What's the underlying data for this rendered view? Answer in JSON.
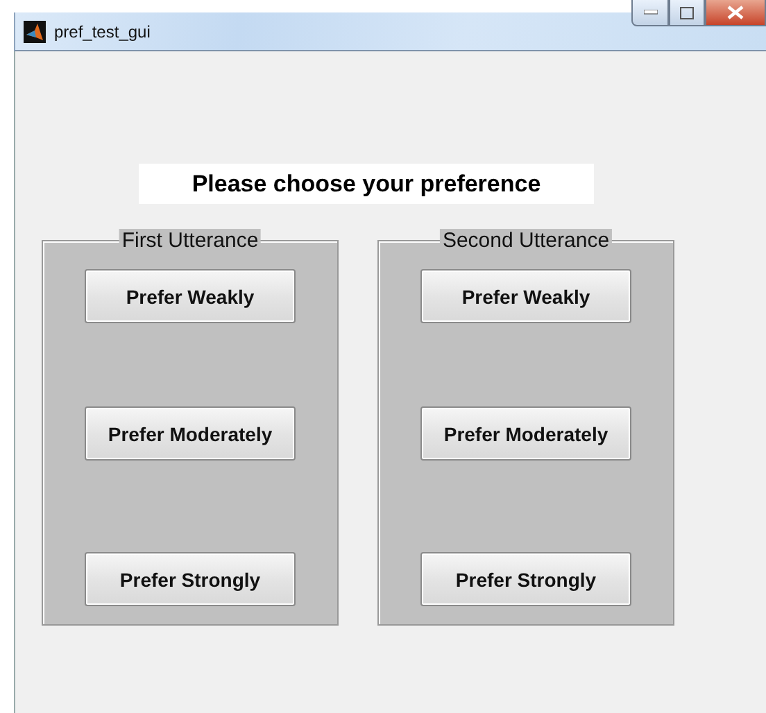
{
  "window": {
    "title": "pref_test_gui"
  },
  "heading": "Please choose your preference",
  "panels": [
    {
      "title": "First Utterance",
      "buttons": [
        "Prefer Weakly",
        "Prefer Moderately",
        "Prefer Strongly"
      ]
    },
    {
      "title": "Second Utterance",
      "buttons": [
        "Prefer Weakly",
        "Prefer Moderately",
        "Prefer Strongly"
      ]
    }
  ]
}
